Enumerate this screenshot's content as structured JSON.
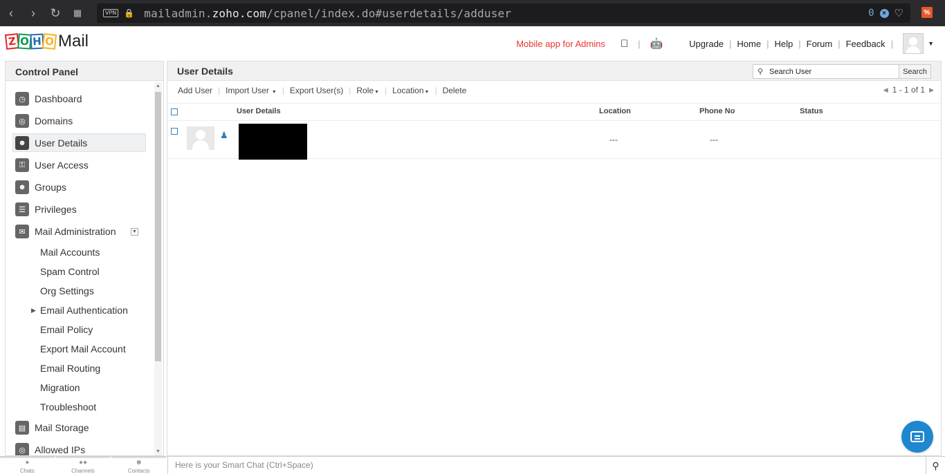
{
  "browser": {
    "url_prefix": "mailadmin.",
    "url_domain": "zoho.com",
    "url_path": "/cpanel/index.do#userdetails/adduser",
    "vpn_label": "VPN",
    "adblock_count": "0"
  },
  "header": {
    "logo_letters": [
      "Z",
      "O",
      "H",
      "O"
    ],
    "logo_text": "Mail",
    "mobile_app_link": "Mobile app for Admins",
    "links": [
      "Upgrade",
      "Home",
      "Help",
      "Forum",
      "Feedback"
    ]
  },
  "sidebar": {
    "title": "Control Panel",
    "items": [
      {
        "label": "Dashboard",
        "icon": "dashboard-icon"
      },
      {
        "label": "Domains",
        "icon": "domains-icon"
      },
      {
        "label": "User Details",
        "icon": "user-icon",
        "active": true
      },
      {
        "label": "User Access",
        "icon": "user-access-icon"
      },
      {
        "label": "Groups",
        "icon": "groups-icon"
      },
      {
        "label": "Privileges",
        "icon": "privileges-icon"
      },
      {
        "label": "Mail Administration",
        "icon": "mail-icon"
      }
    ],
    "sub_items": [
      "Mail Accounts",
      "Spam Control",
      "Org Settings",
      "Email Authentication",
      "Email Policy",
      "Export Mail Account",
      "Email Routing",
      "Migration",
      "Troubleshoot"
    ],
    "bottom_items": [
      {
        "label": "Mail Storage",
        "icon": "storage-icon"
      },
      {
        "label": "Allowed IPs",
        "icon": "allowed-ips-icon"
      }
    ]
  },
  "main": {
    "title": "User Details",
    "search_placeholder": "Search User",
    "search_button": "Search",
    "toolbar": {
      "add_user": "Add User",
      "import_user": "Import User",
      "export_users": "Export User(s)",
      "role": "Role",
      "location": "Location",
      "delete": "Delete"
    },
    "pager": "1 - 1 of 1",
    "columns": [
      "User Details",
      "Location",
      "Phone No",
      "Status"
    ],
    "rows": [
      {
        "location": "---",
        "phone": "---",
        "status": ""
      }
    ]
  },
  "bottom_bar": {
    "tabs": [
      "Chats",
      "Channels",
      "Contacts"
    ],
    "smart_chat_placeholder": "Here is your Smart Chat (Ctrl+Space)"
  }
}
